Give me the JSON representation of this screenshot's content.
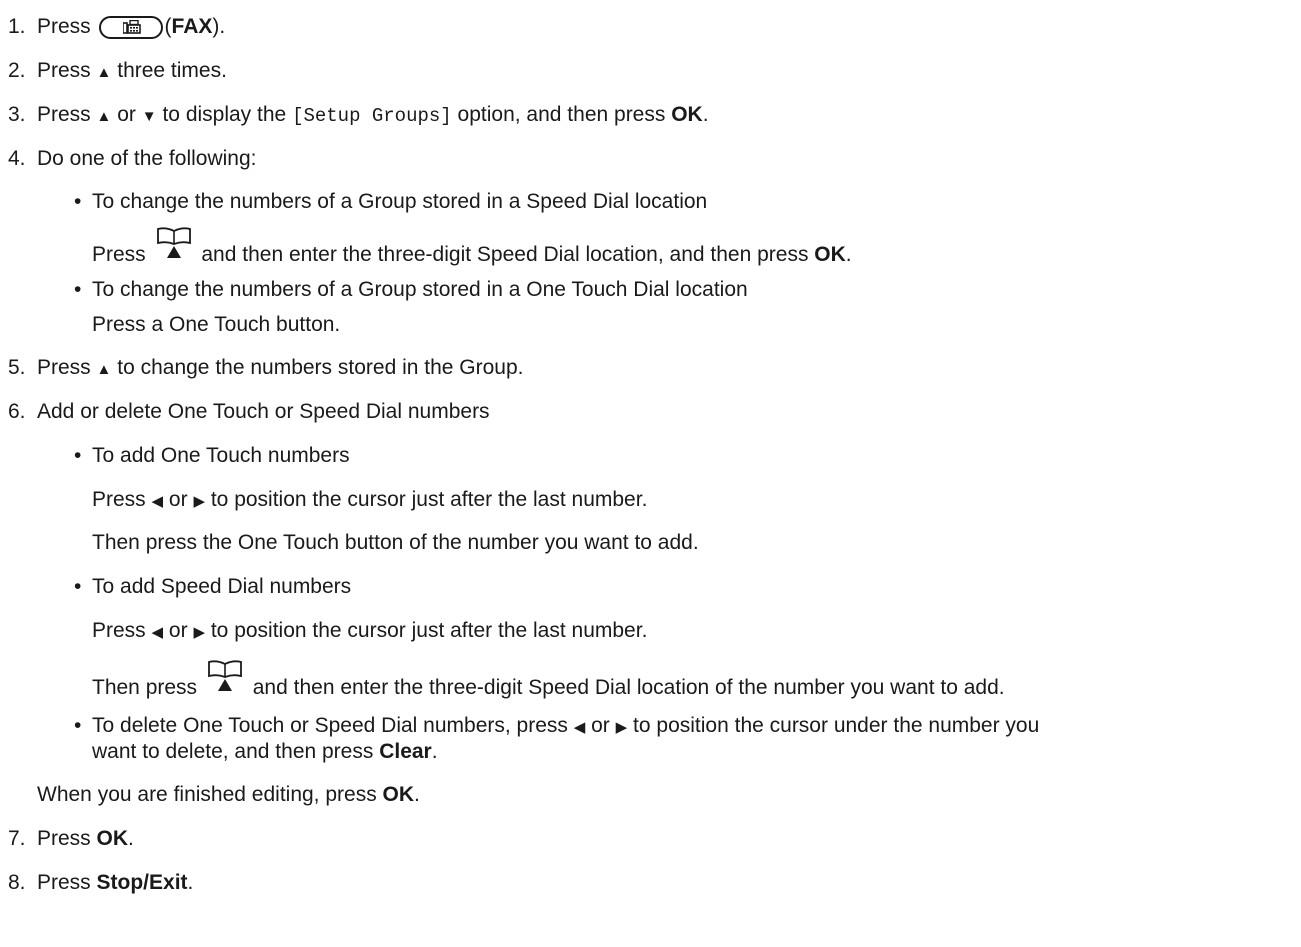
{
  "steps": {
    "s1": {
      "num": "1.",
      "pre": "Press",
      "post": "(",
      "bold": "FAX",
      "end": ")."
    },
    "s2": {
      "num": "2.",
      "pre": "Press",
      "arrow": "▲",
      "post": "three times."
    },
    "s3": {
      "num": "3.",
      "pre": "Press",
      "arrow1": "▲",
      "or": "or",
      "arrow2": "▼",
      "mid": "to display the",
      "code": "[Setup Groups]",
      "post": "option, and then press",
      "bold": "OK",
      "end": "."
    },
    "s4": {
      "num": "4.",
      "text": "Do one of the following:",
      "b1": {
        "bullet": "•",
        "text": "To change the numbers of a Group stored in a Speed Dial location",
        "pre": "Press",
        "post": "and then enter the three-digit Speed Dial location, and then press",
        "bold": "OK",
        "end": "."
      },
      "b2": {
        "bullet": "•",
        "text": "To change the numbers of a Group stored in a One Touch Dial location",
        "sub": "Press a One Touch button."
      }
    },
    "s5": {
      "num": "5.",
      "pre": "Press",
      "arrow": "▲",
      "post": "to change the numbers stored in the Group."
    },
    "s6": {
      "num": "6.",
      "text": "Add or delete One Touch or Speed Dial numbers",
      "b1": {
        "bullet": "•",
        "text": "To add One Touch numbers",
        "line1_pre": "Press",
        "left": "◀",
        "or": "or",
        "right": "▶",
        "line1_post": "to position the cursor just after the last number.",
        "line2": "Then press the One Touch button of the number you want to add."
      },
      "b2": {
        "bullet": "•",
        "text": "To add Speed Dial numbers",
        "line1_pre": "Press",
        "left": "◀",
        "or": "or",
        "right": "▶",
        "line1_post": "to position the cursor just after the last number.",
        "line2_pre": "Then press",
        "line2_post": "and then enter the three-digit Speed Dial location of the number you want to add."
      },
      "b3": {
        "bullet": "•",
        "pre": "To delete One Touch or Speed Dial numbers, press",
        "left": "◀",
        "or": "or",
        "right": "▶",
        "mid": "to position the cursor under the number you",
        "line2_pre": "want to delete, and then press",
        "bold": "Clear",
        "end": "."
      },
      "finish_pre": "When you are finished editing, press",
      "finish_bold": "OK",
      "finish_end": "."
    },
    "s7": {
      "num": "7.",
      "pre": "Press",
      "bold": "OK",
      "end": "."
    },
    "s8": {
      "num": "8.",
      "pre": "Press",
      "bold": "Stop/Exit",
      "end": "."
    }
  },
  "icons": {
    "fax": "fax-icon",
    "address_book": "address-book-icon"
  }
}
